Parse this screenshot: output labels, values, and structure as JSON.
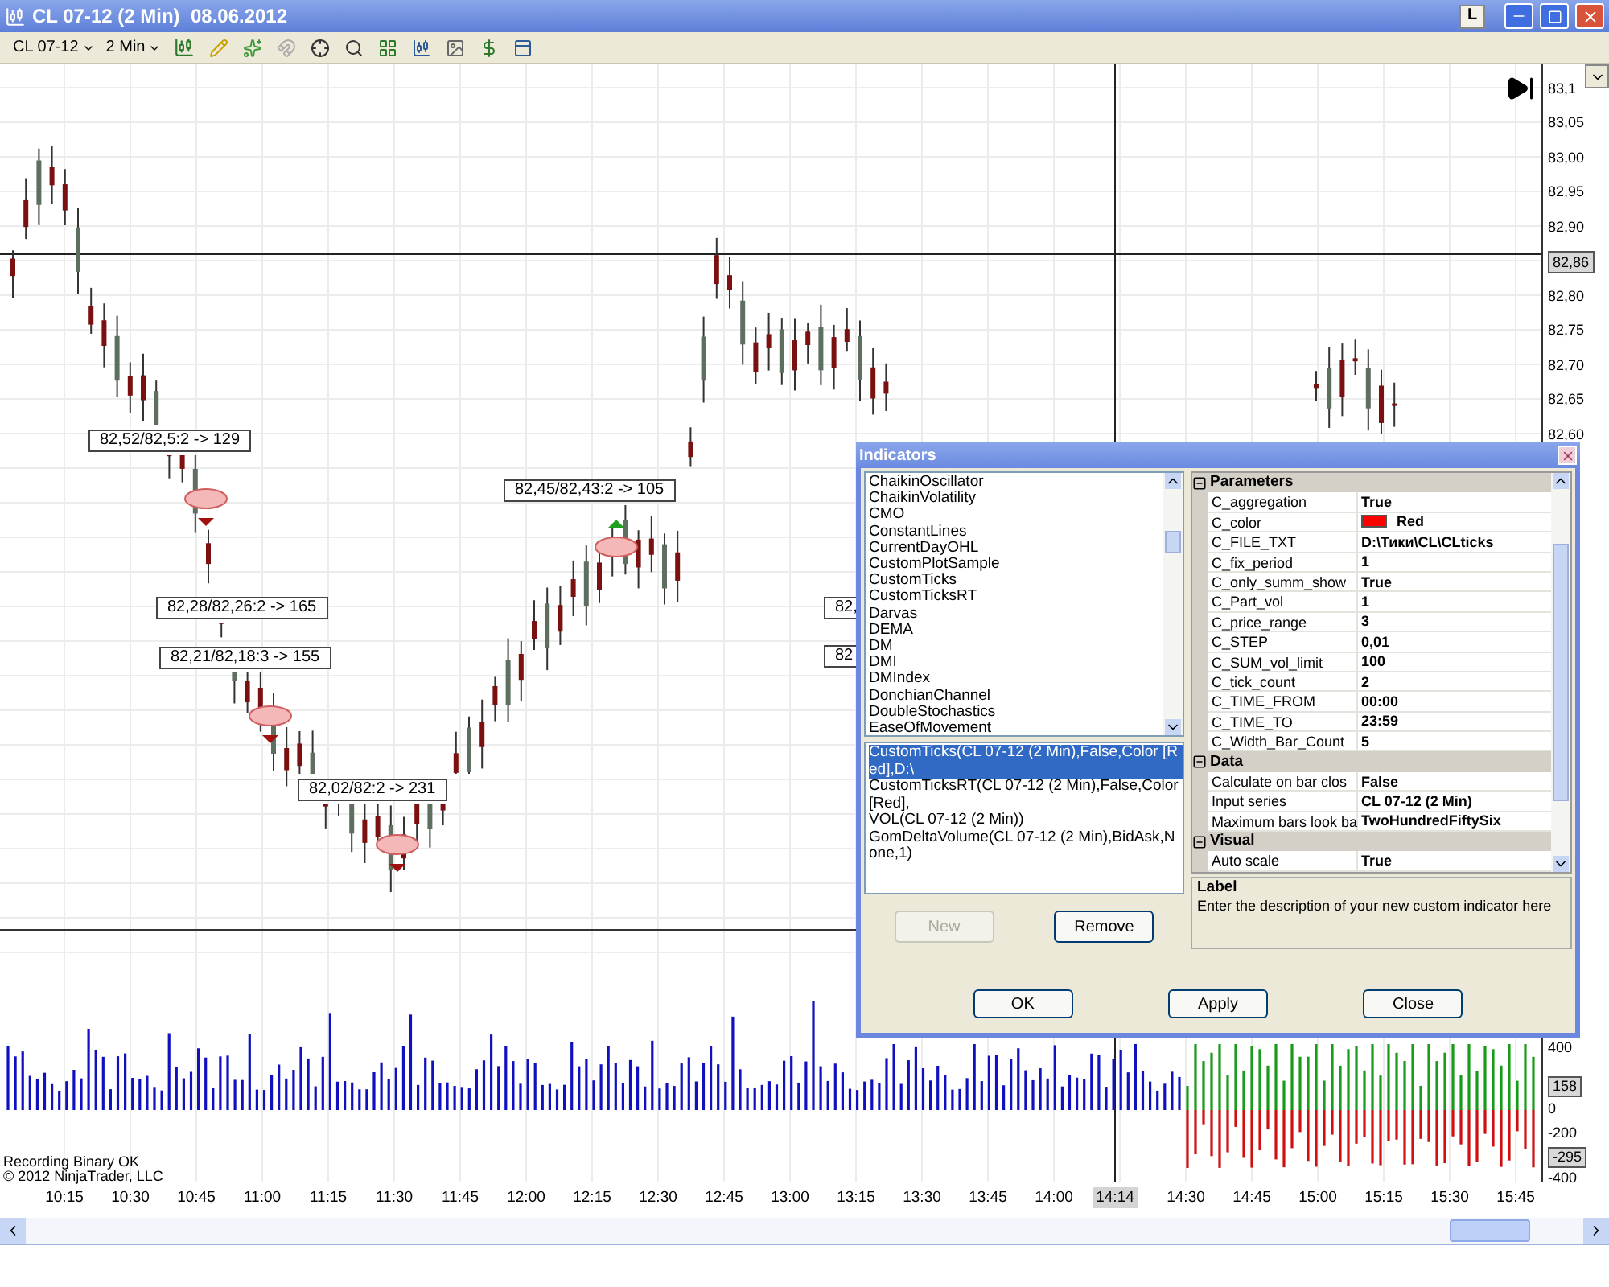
{
  "window": {
    "title": "CL 07-12 (2 Min)  08.06.2012",
    "pin_button": "L"
  },
  "toolbar": {
    "instrument": "CL 07-12",
    "interval": "2 Min"
  },
  "price_axis": [
    {
      "text": "83,1",
      "kind": "tick"
    },
    {
      "text": "83,05",
      "kind": "tick"
    },
    {
      "text": "83,00",
      "kind": "tick"
    },
    {
      "text": "82,95",
      "kind": "tick"
    },
    {
      "text": "82,90",
      "kind": "tick"
    },
    {
      "text": "82,86",
      "kind": "marker"
    },
    {
      "text": "82,80",
      "kind": "tick"
    },
    {
      "text": "82,75",
      "kind": "tick"
    },
    {
      "text": "82,70",
      "kind": "tick"
    },
    {
      "text": "82,65",
      "kind": "tick"
    },
    {
      "text": "82,60",
      "kind": "tick"
    }
  ],
  "volume_axis": [
    {
      "text": "400",
      "kind": "tick"
    },
    {
      "text": "158",
      "kind": "marker"
    },
    {
      "text": "0",
      "kind": "tick"
    },
    {
      "text": "-200",
      "kind": "tick"
    },
    {
      "text": "-295",
      "kind": "marker"
    },
    {
      "text": "-400",
      "kind": "tick"
    }
  ],
  "annotations": [
    {
      "text": "82,52/82,5:2 -> 129"
    },
    {
      "text": "82,45/82,43:2 -> 105"
    },
    {
      "text": "82,28/82,26:2 -> 165"
    },
    {
      "text": "82,21/82,18:3 -> 155"
    },
    {
      "text": "82,02/82:2 -> 231"
    },
    {
      "text": "82,"
    },
    {
      "text": "82"
    }
  ],
  "time_axis": [
    {
      "text": "10:15",
      "kind": "tick"
    },
    {
      "text": "10:30",
      "kind": "tick"
    },
    {
      "text": "10:45",
      "kind": "tick"
    },
    {
      "text": "11:00",
      "kind": "tick"
    },
    {
      "text": "11:15",
      "kind": "tick"
    },
    {
      "text": "11:30",
      "kind": "tick"
    },
    {
      "text": "11:45",
      "kind": "tick"
    },
    {
      "text": "12:00",
      "kind": "tick"
    },
    {
      "text": "12:15",
      "kind": "tick"
    },
    {
      "text": "12:30",
      "kind": "tick"
    },
    {
      "text": "12:45",
      "kind": "tick"
    },
    {
      "text": "13:00",
      "kind": "tick"
    },
    {
      "text": "13:15",
      "kind": "tick"
    },
    {
      "text": "13:30",
      "kind": "tick"
    },
    {
      "text": "13:45",
      "kind": "tick"
    },
    {
      "text": "14:00",
      "kind": "tick"
    },
    {
      "text": "14:14",
      "kind": "cursor"
    },
    {
      "text": "14:30",
      "kind": "tick"
    },
    {
      "text": "14:45",
      "kind": "tick"
    },
    {
      "text": "15:00",
      "kind": "tick"
    },
    {
      "text": "15:15",
      "kind": "tick"
    },
    {
      "text": "15:30",
      "kind": "tick"
    },
    {
      "text": "15:45",
      "kind": "tick"
    }
  ],
  "status": [
    "Recording Binary OK",
    "© 2012 NinjaTrader, LLC"
  ],
  "dialog": {
    "title": "Indicators",
    "available": [
      {
        "label": "ChaikinOscillator",
        "selected": false
      },
      {
        "label": "ChaikinVolatility",
        "selected": false
      },
      {
        "label": "CMO",
        "selected": false
      },
      {
        "label": "ConstantLines",
        "selected": false
      },
      {
        "label": "CurrentDayOHL",
        "selected": false
      },
      {
        "label": "CustomPlotSample",
        "selected": false
      },
      {
        "label": "CustomTicks",
        "selected": false
      },
      {
        "label": "CustomTicksRT",
        "selected": false
      },
      {
        "label": "Darvas",
        "selected": false
      },
      {
        "label": "DEMA",
        "selected": false
      },
      {
        "label": "DM",
        "selected": false
      },
      {
        "label": "DMI",
        "selected": false
      },
      {
        "label": "DMIndex",
        "selected": false
      },
      {
        "label": "DonchianChannel",
        "selected": false
      },
      {
        "label": "DoubleStochastics",
        "selected": false
      },
      {
        "label": "EaseOfMovement",
        "selected": false
      }
    ],
    "configured": [
      {
        "label": "CustomTicks(CL 07-12 (2 Min),False,Color [Red],D:\\",
        "selected": true
      },
      {
        "label": "CustomTicksRT(CL 07-12 (2 Min),False,Color [Red],",
        "selected": false
      },
      {
        "label": "VOL(CL 07-12 (2 Min))",
        "selected": false
      },
      {
        "label": "GomDeltaVolume(CL 07-12 (2 Min),BidAsk,None,1)",
        "selected": false
      }
    ],
    "list_buttons": [
      {
        "label": "New",
        "disabled": true
      },
      {
        "label": "Remove",
        "disabled": false
      }
    ],
    "properties": [
      {
        "category": "Parameters",
        "expanded": true,
        "rows": [
          {
            "name": "C_aggregation",
            "value": "True"
          },
          {
            "name": "C_color",
            "value": "Red",
            "color": "#ff0000"
          },
          {
            "name": "C_FILE_TXT",
            "value": "D:\\Тики\\CL\\CLticks"
          },
          {
            "name": "C_fix_period",
            "value": "1"
          },
          {
            "name": "C_only_summ_show",
            "value": "True"
          },
          {
            "name": "C_Part_vol",
            "value": "1"
          },
          {
            "name": "C_price_range",
            "value": "3"
          },
          {
            "name": "C_STEP",
            "value": "0,01"
          },
          {
            "name": "C_SUM_vol_limit",
            "value": "100"
          },
          {
            "name": "C_tick_count",
            "value": "2"
          },
          {
            "name": "C_TIME_FROM",
            "value": "00:00"
          },
          {
            "name": "C_TIME_TO",
            "value": "23:59"
          },
          {
            "name": "C_Width_Bar_Count",
            "value": "5"
          }
        ]
      },
      {
        "category": "Data",
        "expanded": true,
        "rows": [
          {
            "name": "Calculate on bar clos",
            "value": "False"
          },
          {
            "name": "Input series",
            "value": "CL 07-12 (2 Min)"
          },
          {
            "name": "Maximum bars look ba",
            "value": "TwoHundredFiftySix"
          }
        ]
      },
      {
        "category": "Visual",
        "expanded": true,
        "rows": [
          {
            "name": "Auto scale",
            "value": "True"
          }
        ]
      }
    ],
    "description": {
      "title": "Label",
      "text": "Enter the description of your new custom indicator here"
    },
    "buttons": [
      "OK",
      "Apply",
      "Close"
    ]
  }
}
